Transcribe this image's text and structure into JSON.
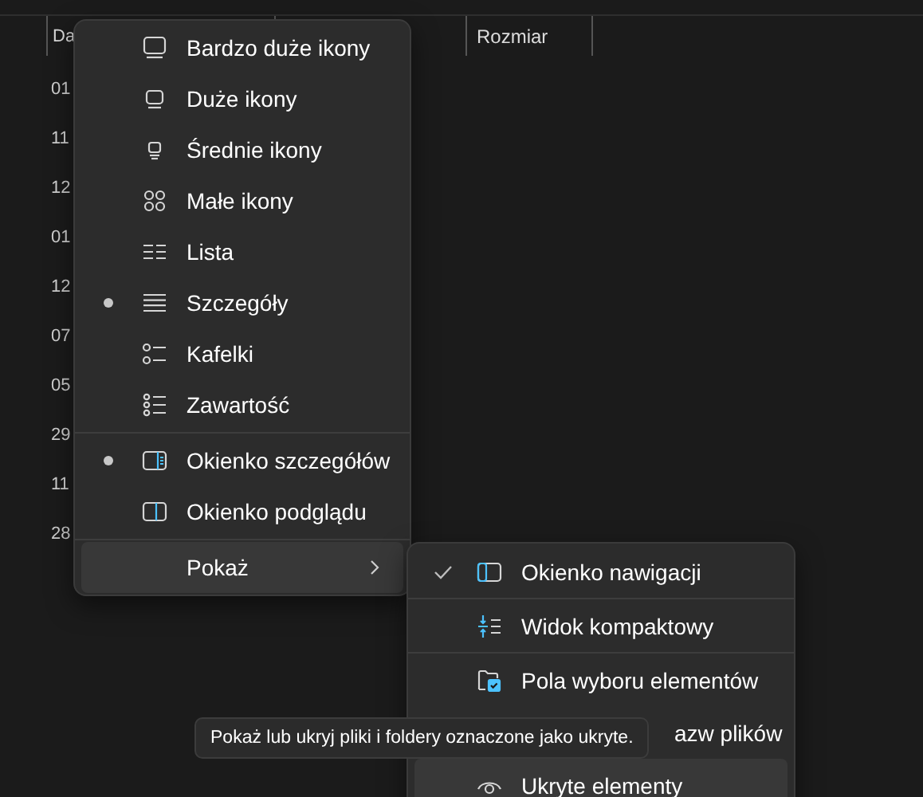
{
  "file_list": {
    "columns": [
      "Da",
      "Rozmiar"
    ],
    "rows": [
      "01",
      "11",
      "12",
      "01",
      "12",
      "07",
      "05",
      "29",
      "11",
      "28"
    ]
  },
  "view_menu": {
    "groups": [
      [
        {
          "label": "Bardzo duże ikony",
          "selected": false
        },
        {
          "label": "Duże ikony",
          "selected": false
        },
        {
          "label": "Średnie ikony",
          "selected": false
        },
        {
          "label": "Małe ikony",
          "selected": false
        },
        {
          "label": "Lista",
          "selected": false
        },
        {
          "label": "Szczegóły",
          "selected": true
        },
        {
          "label": "Kafelki",
          "selected": false
        },
        {
          "label": "Zawartość",
          "selected": false
        }
      ],
      [
        {
          "label": "Okienko szczegółów",
          "selected": true
        },
        {
          "label": "Okienko podglądu",
          "selected": false
        }
      ]
    ],
    "show_item": {
      "label": "Pokaż",
      "highlighted": true
    }
  },
  "show_submenu": {
    "groups": [
      [
        {
          "label": "Okienko nawigacji",
          "checked": true,
          "highlighted": false
        }
      ],
      [
        {
          "label": "Widok kompaktowy",
          "checked": false,
          "highlighted": false
        }
      ],
      [
        {
          "label": "Pola wyboru elementów",
          "checked": false,
          "highlighted": false
        },
        {
          "label": "azw plików",
          "kind": "cut",
          "highlighted": false
        },
        {
          "label": "Ukryte elementy",
          "checked": false,
          "highlighted": true
        }
      ]
    ]
  },
  "tooltip": {
    "text": "Pokaż lub ukryj pliki i foldery oznaczone jako ukryte."
  }
}
